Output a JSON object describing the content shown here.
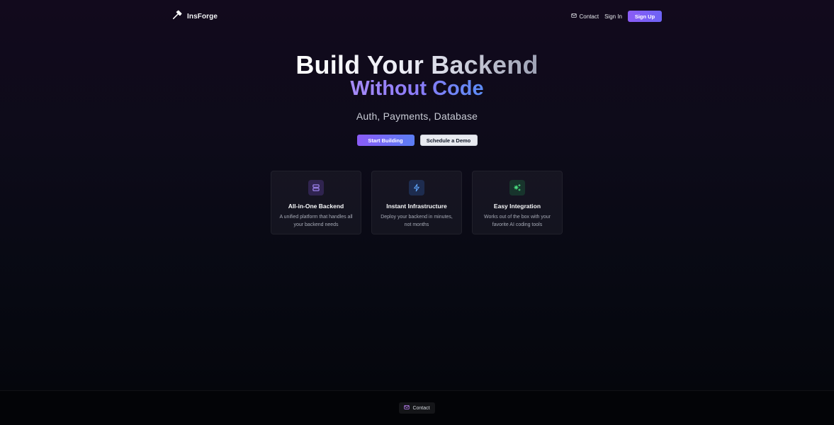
{
  "brand": {
    "name": "InsForge",
    "icon": "hammer-icon"
  },
  "nav": {
    "contact_label": "Contact",
    "contact_icon": "mail-icon",
    "signin_label": "Sign In",
    "signup_label": "Sign Up"
  },
  "hero": {
    "title_line1": "Build Your Backend",
    "title_line2": "Without Code",
    "subtitle": "Auth, Payments, Database",
    "primary_cta": "Start Building",
    "secondary_cta": "Schedule a Demo"
  },
  "features": [
    {
      "icon": "server-icon",
      "title": "All-in-One Backend",
      "description": "A unified platform that handles all your backend needs",
      "accent": "#a78bfa"
    },
    {
      "icon": "lightning-icon",
      "title": "Instant Infrastructure",
      "description": "Deploy your backend in minutes, not months",
      "accent": "#60a5fa"
    },
    {
      "icon": "sparkles-icon",
      "title": "Easy Integration",
      "description": "Works out of the box with your favorite AI coding tools",
      "accent": "#4ade80"
    }
  ],
  "footer": {
    "contact_label": "Contact",
    "contact_icon": "mail-icon"
  },
  "colors": {
    "accent_purple": "#8b5cf6",
    "accent_blue": "#5b7ef5",
    "background": "#0b0b16"
  }
}
